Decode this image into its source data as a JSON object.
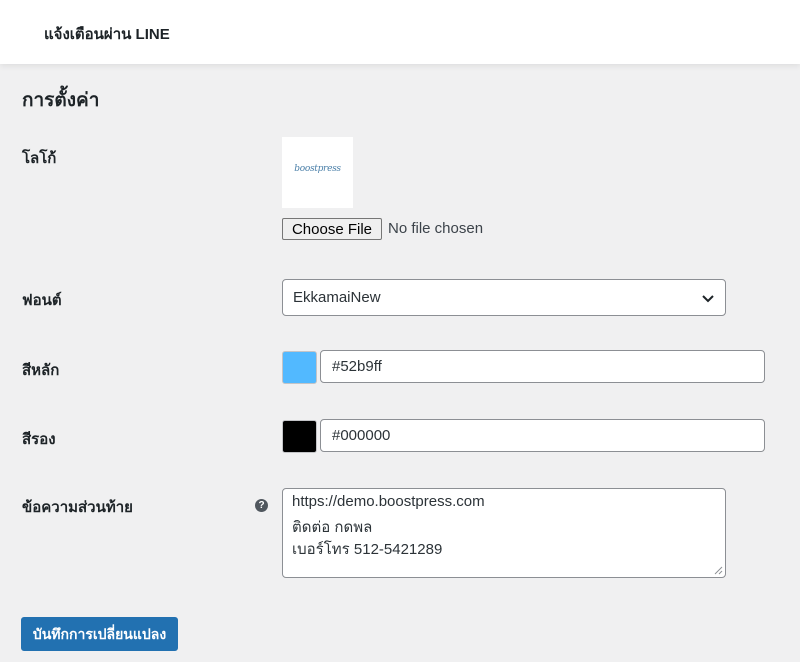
{
  "header": {
    "title": "แจ้งเตือนผ่าน LINE"
  },
  "section": {
    "title": "การตั้งค่า"
  },
  "logo": {
    "label": "โลโก้",
    "image_text": "boostpress",
    "choose_file_label": "Choose File",
    "file_status": "No file chosen"
  },
  "font": {
    "label": "ฟอนต์",
    "selected": "EkkamaiNew",
    "icon": "chevron-down-icon"
  },
  "primary_color": {
    "label": "สีหลัก",
    "value": "#52b9ff",
    "swatch_color": "#52b9ff"
  },
  "secondary_color": {
    "label": "สีรอง",
    "value": "#000000",
    "swatch_color": "#000000"
  },
  "footer_text": {
    "label": "ข้อความส่วนท้าย",
    "help_icon": "?",
    "lines": [
      "https://demo.boostpress.com",
      "ติดต่อ กดพล",
      "เบอร์โทร 512-5421289"
    ]
  },
  "save_button": {
    "label": "บันทึกการเปลี่ยนแปลง",
    "color": "#2271b1"
  }
}
